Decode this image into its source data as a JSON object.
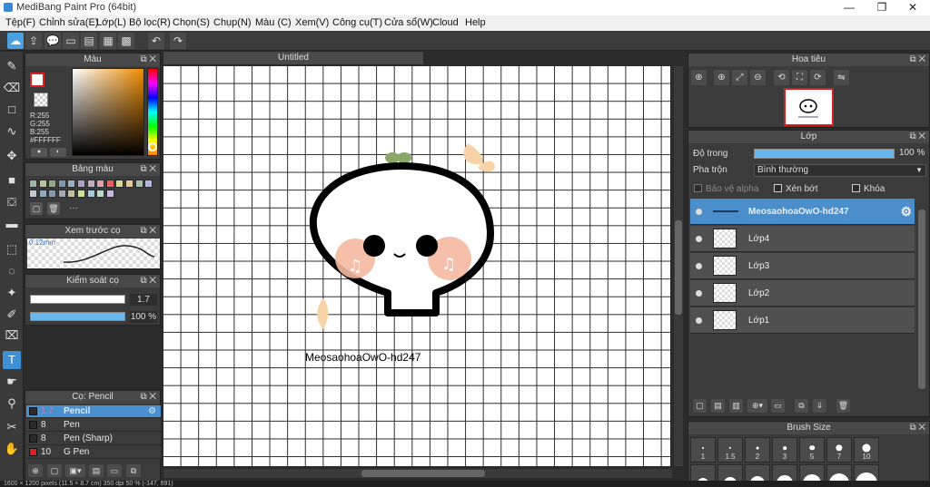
{
  "window": {
    "title": "MediBang Paint Pro (64bit)",
    "minimize": "—",
    "maximize": "❐",
    "close": "✕"
  },
  "menu": [
    "Tệp(F)",
    "Chỉnh sửa(E)",
    "Lớp(L)",
    "Bộ lọc(R)",
    "Chọn(S)",
    "Chụp(N)",
    "Màu (C)",
    "Xem(V)",
    "Công cụ(T)",
    "Cửa sổ(W)",
    "Cloud",
    "Help"
  ],
  "panels": {
    "color": {
      "title": "Màu",
      "r": "R:255",
      "g": "G:255",
      "b": "B:255",
      "hex": "#FFFFFF",
      "fg": "#ffffff",
      "bg": "transparent"
    },
    "palette": {
      "title": "Bảng màu",
      "more": "···",
      "colors": [
        "#9fb7a0",
        "#b7c49c",
        "#8fa88f",
        "#7f99b0",
        "#9ab0c8",
        "#b0a0c8",
        "#c8a8c8",
        "#e0a0b0",
        "#e86060",
        "#d8d8a0",
        "#e8c890",
        "#a8c0a8",
        "#b0b8e0",
        "#c0c8d0",
        "#90a8b8",
        "#8898a8",
        "#a0a8b0",
        "#c0c0a0",
        "#d0e0a0",
        "#a8c8e0",
        "#b8d8c8",
        "#c8b8d8"
      ]
    },
    "brush_preview": {
      "title": "Xem trước cọ",
      "size": "0.12mm"
    },
    "brush_control": {
      "title": "Kiểm soát cọ",
      "size_value": "1.7",
      "opacity_value": "100 %"
    },
    "brush_list": {
      "title": "Cọ: Pencil",
      "items": [
        {
          "size": "1.7",
          "name": "Pencil",
          "color": "#2b2b2b",
          "selected": true
        },
        {
          "size": "8",
          "name": "Pen",
          "color": "#2b2b2b",
          "selected": false
        },
        {
          "size": "8",
          "name": "Pen (Sharp)",
          "color": "#2b2b2b",
          "selected": false
        },
        {
          "size": "10",
          "name": "G Pen",
          "color": "#e02020",
          "selected": false
        }
      ]
    },
    "navigator": {
      "title": "Hoa tiêu"
    },
    "layer": {
      "title": "Lớp",
      "opacity_label": "Độ trong",
      "opacity_value": "100 %",
      "blend_label": "Pha trộn",
      "blend_value": "Bình thường",
      "protect_alpha": "Bảo vệ alpha",
      "clipping": "Xén bớt",
      "lock": "Khóa",
      "layers": [
        {
          "name": "MeosaohoaOwO-hd247",
          "selected": true
        },
        {
          "name": "Lớp4",
          "selected": false
        },
        {
          "name": "Lớp3",
          "selected": false
        },
        {
          "name": "Lớp2",
          "selected": false
        },
        {
          "name": "Lớp1",
          "selected": false
        }
      ]
    },
    "brush_size": {
      "title": "Brush Size",
      "sizes": [
        "1",
        "1.5",
        "2",
        "3",
        "5",
        "7",
        "10"
      ]
    }
  },
  "canvas": {
    "tab": "Untitled",
    "caption": "MeosaohoaOwO-hd247"
  },
  "status": "1600 × 1200 pixels (11.5 × 8.7 cm)  350 dpi  50 %  (-147, 691)",
  "icons": {
    "gear": "⚙"
  }
}
